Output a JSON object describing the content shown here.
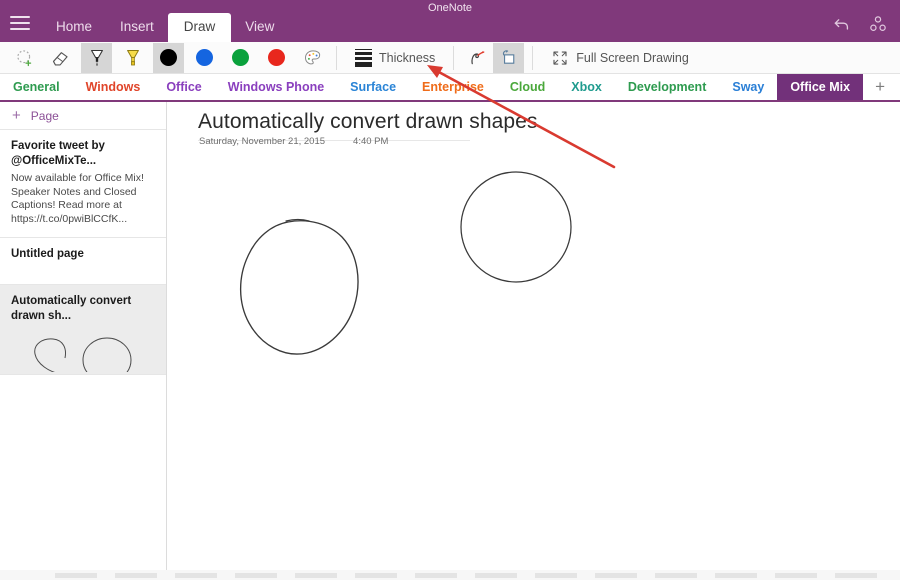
{
  "window": {
    "app_title": "OneNote",
    "menu_icon": "hamburger-icon",
    "undo_icon": "undo-icon",
    "share_icon": "share-icon"
  },
  "ribbon": {
    "tabs": [
      {
        "label": "Home",
        "active": false
      },
      {
        "label": "Insert",
        "active": false
      },
      {
        "label": "Draw",
        "active": true
      },
      {
        "label": "View",
        "active": false
      }
    ]
  },
  "toolbar": {
    "tools": [
      {
        "name": "lasso-select-icon",
        "label": "Lasso Select",
        "selected": false
      },
      {
        "name": "eraser-icon",
        "label": "Eraser",
        "selected": false
      },
      {
        "name": "pen-icon",
        "label": "Pen",
        "selected": true
      },
      {
        "name": "highlighter-icon",
        "label": "Highlighter",
        "selected": false
      }
    ],
    "colors": [
      {
        "name": "color-black",
        "hex": "#000000",
        "selected": true
      },
      {
        "name": "color-blue",
        "hex": "#1565e0",
        "selected": false
      },
      {
        "name": "color-green",
        "hex": "#0aa13c",
        "selected": false
      },
      {
        "name": "color-red",
        "hex": "#e8271d",
        "selected": false
      }
    ],
    "palette": {
      "name": "color-palette-icon",
      "label": "More Colors"
    },
    "thickness_label": "Thickness",
    "ink_to_text": {
      "name": "ink-to-text-icon",
      "label": "Ink to Text",
      "selected": false
    },
    "ink_to_shape": {
      "name": "ink-to-shape-icon",
      "label": "Ink to Shape",
      "selected": true
    },
    "fullscreen_label": "Full Screen Drawing"
  },
  "sections": [
    {
      "label": "General",
      "color": "#2e9b4f",
      "active": false
    },
    {
      "label": "Windows",
      "color": "#e0452a",
      "active": false
    },
    {
      "label": "Office",
      "color": "#8a3fbe",
      "active": false
    },
    {
      "label": "Windows Phone",
      "color": "#8a3fbe",
      "active": false
    },
    {
      "label": "Surface",
      "color": "#2a84d6",
      "active": false
    },
    {
      "label": "Enterprise",
      "color": "#ef6c1a",
      "active": false
    },
    {
      "label": "Cloud",
      "color": "#4aa83b",
      "active": false
    },
    {
      "label": "Xbox",
      "color": "#1f9b8e",
      "active": false
    },
    {
      "label": "Development",
      "color": "#2e9b4f",
      "active": false
    },
    {
      "label": "Sway",
      "color": "#2a7fd6",
      "active": false
    },
    {
      "label": "Office Mix",
      "color": "#ffffff",
      "active": true
    }
  ],
  "section_add_label": "+",
  "sidebar": {
    "add_page_label": "Page",
    "add_page_icon": "plus-icon",
    "pages": [
      {
        "title": "Favorite tweet by @OfficeMixTe...",
        "preview": "Now available for Office Mix! Speaker Notes and Closed Captions! Read more at https://t.co/0pwiBlCCfK...",
        "selected": false,
        "has_thumb": false
      },
      {
        "title": "Untitled page",
        "preview": "",
        "selected": false,
        "has_thumb": false
      },
      {
        "title": "Automatically convert drawn sh...",
        "preview": "",
        "selected": true,
        "has_thumb": true
      }
    ]
  },
  "page": {
    "title": "Automatically convert drawn shapes",
    "date": "Saturday, November 21, 2015",
    "time": "4:40 PM",
    "ink_shapes": [
      {
        "name": "hand-drawn-ellipse",
        "converted": false
      },
      {
        "name": "converted-circle",
        "converted": true
      }
    ]
  },
  "annotation": {
    "name": "red-pointer-arrow",
    "color": "#d93a30",
    "points_to": "ink-to-shape-icon"
  },
  "bottom_strip": {
    "block_count": 15
  }
}
